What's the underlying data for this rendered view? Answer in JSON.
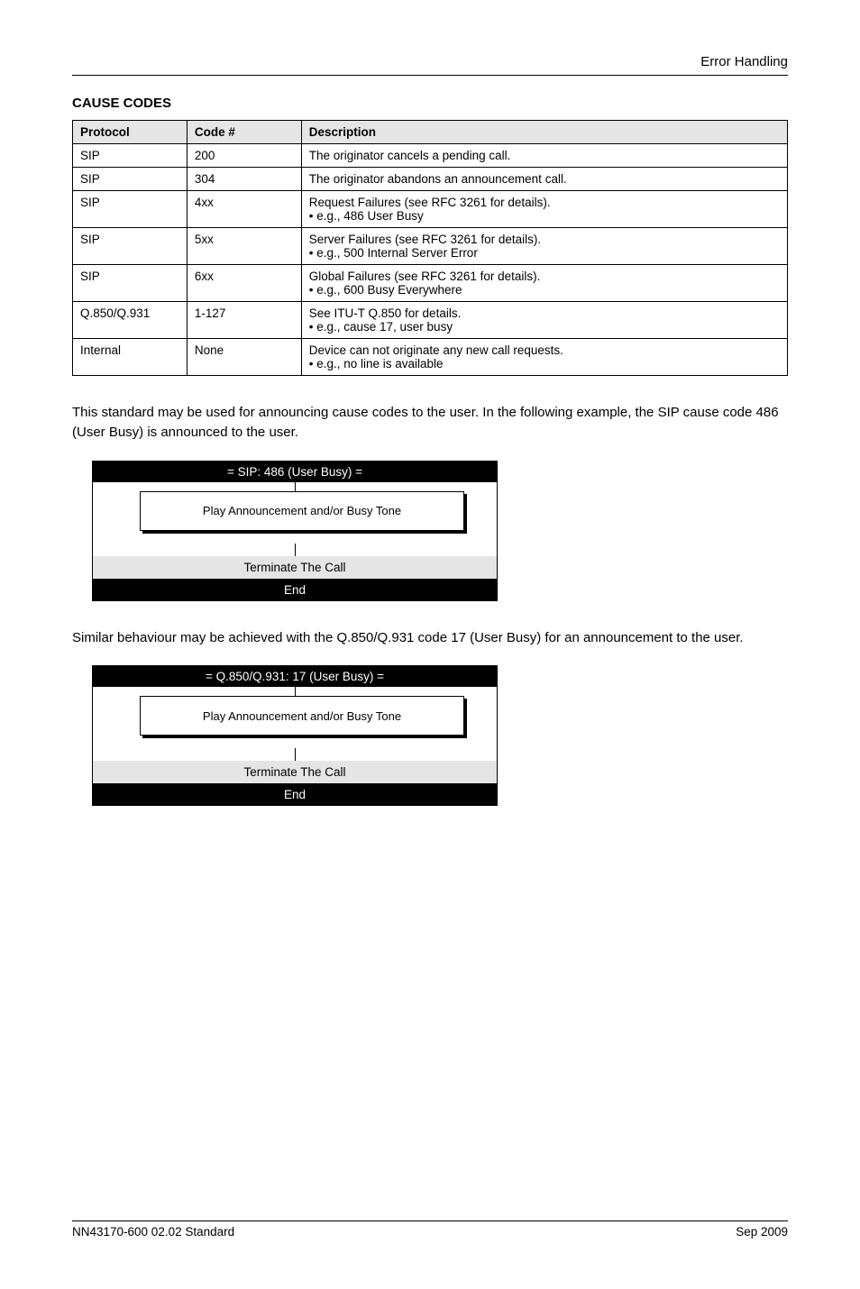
{
  "header": {
    "right": "Error Handling"
  },
  "section": {
    "title": "CAUSE CODES"
  },
  "table": {
    "headers": [
      "Protocol",
      "Code #",
      "Description"
    ],
    "rows": [
      [
        "SIP",
        "200",
        "The originator cancels a pending call."
      ],
      [
        "SIP",
        "304",
        "The originator abandons an announcement call."
      ],
      [
        "SIP",
        "4xx",
        "Request Failures (see RFC 3261 for details).\n• e.g., 486 User Busy"
      ],
      [
        "SIP",
        "5xx",
        "Server Failures (see RFC 3261 for details).\n• e.g., 500 Internal Server Error"
      ],
      [
        "SIP",
        "6xx",
        "Global Failures (see RFC 3261 for details).\n• e.g., 600 Busy Everywhere"
      ],
      [
        "Q.850/Q.931",
        "1-127",
        "See ITU-T Q.850 for details.\n• e.g., cause 17, user busy"
      ],
      [
        "Internal",
        "None",
        "Device can not originate any new call requests.\n• e.g., no line is available"
      ]
    ]
  },
  "para1": "This standard may be used for announcing cause codes to the user. In the following example, the SIP cause code 486 (User Busy) is announced to the user.",
  "diagram1": {
    "title": "= SIP: 486 (User Busy) =",
    "box": "Play Announcement and/or Busy Tone",
    "mid": "Terminate The Call",
    "bottom": "End"
  },
  "para2": "Similar behaviour may be achieved with the Q.850/Q.931 code 17 (User Busy) for an announcement to the user.",
  "diagram2": {
    "title": "= Q.850/Q.931: 17 (User Busy) =",
    "box": "Play Announcement and/or Busy Tone",
    "mid": "Terminate The Call",
    "bottom": "End"
  },
  "footer": {
    "left": "NN43170-600 02.02 Standard",
    "right": "Sep 2009"
  }
}
